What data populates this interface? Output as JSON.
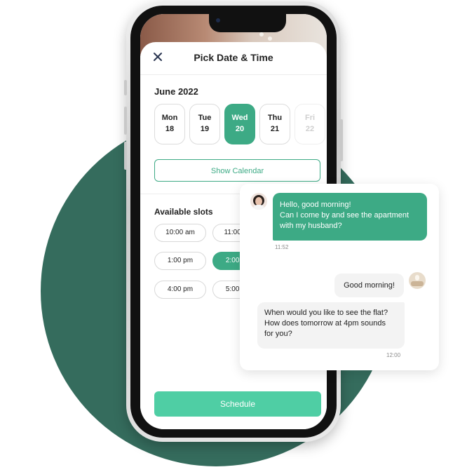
{
  "colors": {
    "background_circle": "#356c5d",
    "accent": "#3daa85",
    "schedule_button": "#4fcea4"
  },
  "modal": {
    "close_icon": "close-icon",
    "title": "Pick Date & Time"
  },
  "calendar": {
    "month": "June 2022",
    "days": [
      {
        "name": "Mon",
        "date": "18",
        "state": "default"
      },
      {
        "name": "Tue",
        "date": "19",
        "state": "default"
      },
      {
        "name": "Wed",
        "date": "20",
        "state": "selected"
      },
      {
        "name": "Thu",
        "date": "21",
        "state": "default"
      },
      {
        "name": "Fri",
        "date": "22",
        "state": "disabled"
      }
    ],
    "show_calendar_label": "Show Calendar"
  },
  "slots": {
    "title": "Available slots",
    "items": [
      {
        "label": "10:00 am",
        "selected": false
      },
      {
        "label": "11:00 am",
        "selected": false
      },
      {
        "label": "1:00 pm",
        "selected": false
      },
      {
        "label": "2:00 pm",
        "selected": true
      },
      {
        "label": "4:00 pm",
        "selected": false
      },
      {
        "label": "5:00 pm",
        "selected": false
      }
    ]
  },
  "schedule_label": "Schedule",
  "chat": {
    "messages": [
      {
        "from": "guest",
        "lines": [
          "Hello, good morning!",
          "Can I come by and see the apartment",
          "with my husband?"
        ],
        "time": "11:52"
      },
      {
        "from": "host",
        "lines": [
          "Good morning!"
        ]
      },
      {
        "from": "host",
        "lines": [
          "When would you like to see the flat?",
          "How does tomorrow at 4pm sounds",
          "for you?"
        ],
        "time": "12:00"
      }
    ]
  }
}
